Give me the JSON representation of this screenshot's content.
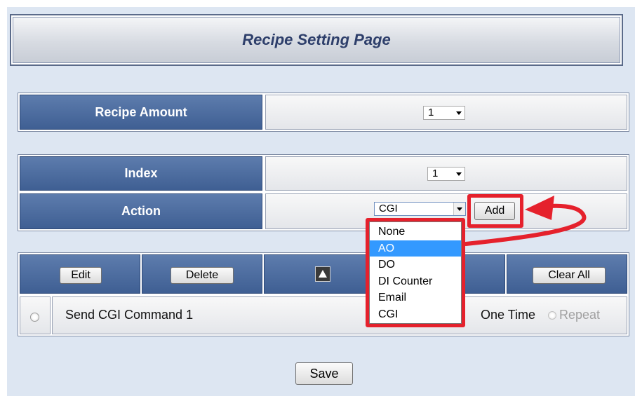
{
  "title": "Recipe Setting Page",
  "recipe_amount": {
    "label": "Recipe Amount",
    "value": "1"
  },
  "index": {
    "label": "Index",
    "value": "1"
  },
  "action": {
    "label": "Action",
    "value": "CGI",
    "add_label": "Add",
    "options": [
      "None",
      "AO",
      "DO",
      "DI Counter",
      "Email",
      "CGI"
    ],
    "highlighted_option": "AO"
  },
  "toolbar": {
    "edit_label": "Edit",
    "delete_label": "Delete",
    "clear_all_label": "Clear All"
  },
  "actions_list": [
    {
      "label": "Send CGI Command 1",
      "mode_one_time": "One Time",
      "mode_repeat": "Repeat"
    }
  ],
  "save_label": "Save",
  "colors": {
    "header_blue": "#3f5f93",
    "highlight_red": "#e5212c",
    "selected_option": "#3399ff",
    "title_text": "#2e3f6b"
  },
  "icons": {
    "move_up": "triangle-up-icon",
    "callout": "red-arrow-icon"
  }
}
